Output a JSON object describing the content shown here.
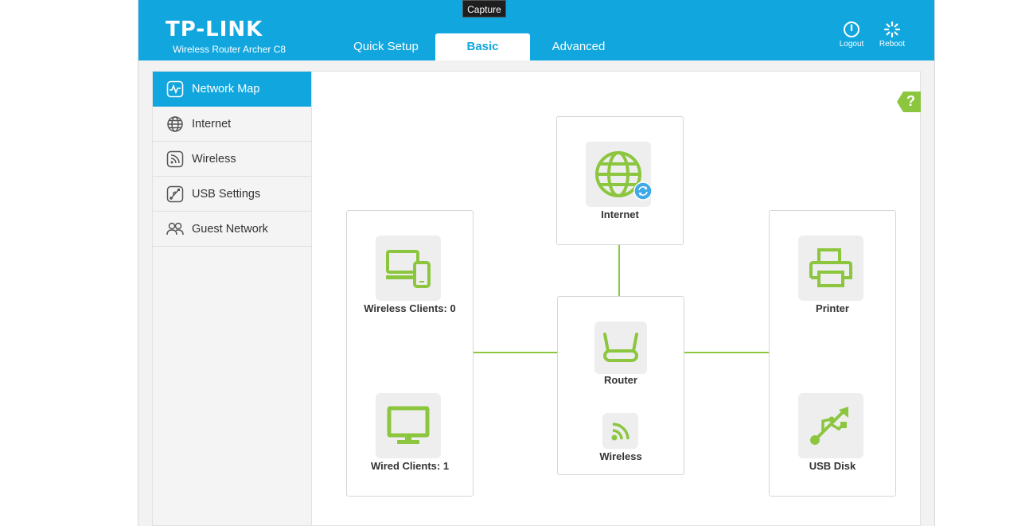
{
  "tooltip": "Capture",
  "header": {
    "logo": "TP-LINK",
    "model": "Wireless Router Archer C8",
    "tabs": [
      {
        "label": "Quick Setup"
      },
      {
        "label": "Basic"
      },
      {
        "label": "Advanced"
      }
    ],
    "logout_label": "Logout",
    "reboot_label": "Reboot"
  },
  "sidebar": {
    "items": [
      {
        "label": "Network Map",
        "icon": "network-map-icon"
      },
      {
        "label": "Internet",
        "icon": "globe-icon"
      },
      {
        "label": "Wireless",
        "icon": "wireless-icon"
      },
      {
        "label": "USB Settings",
        "icon": "usb-settings-icon"
      },
      {
        "label": "Guest Network",
        "icon": "guest-network-icon"
      }
    ]
  },
  "help_label": "?",
  "map": {
    "internet": "Internet",
    "wireless_clients": "Wireless Clients: 0",
    "wired_clients": "Wired Clients: 1",
    "router": "Router",
    "wireless": "Wireless",
    "printer": "Printer",
    "usb_disk": "USB Disk"
  },
  "colors": {
    "accent": "#11a6de",
    "green": "#8cc63f"
  }
}
